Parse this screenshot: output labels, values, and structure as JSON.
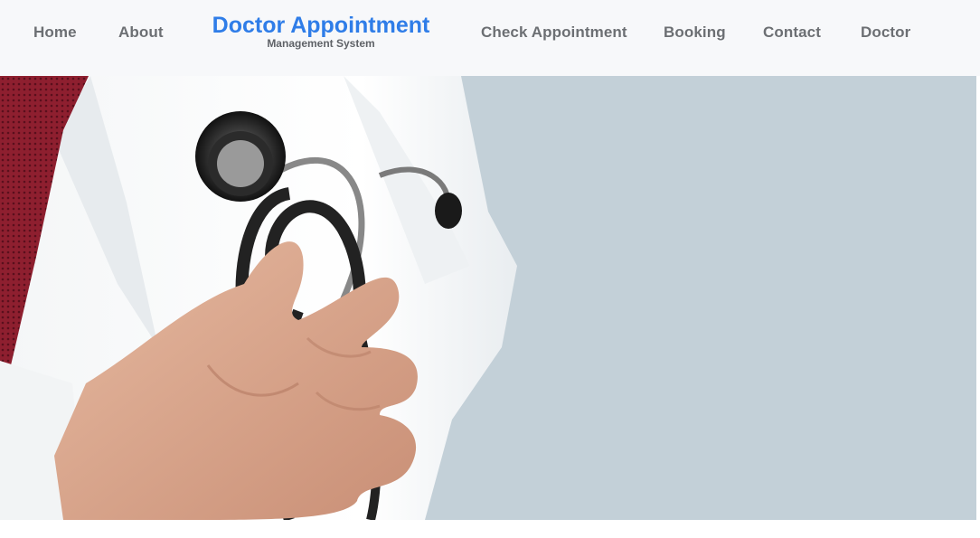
{
  "nav": {
    "home": "Home",
    "about": "About",
    "brand_title": "Doctor Appointment",
    "brand_subtitle": "Management System",
    "check_appointment": "Check Appointment",
    "booking": "Booking",
    "contact": "Contact",
    "doctor": "Doctor"
  },
  "hero": {
    "image": "doctor-holding-stethoscope-photo"
  },
  "colors": {
    "brand": "#2f7de8",
    "nav_text": "#6c6f73",
    "nav_bg": "#f7f8fa",
    "hero_bg": "#c3d0d8"
  }
}
